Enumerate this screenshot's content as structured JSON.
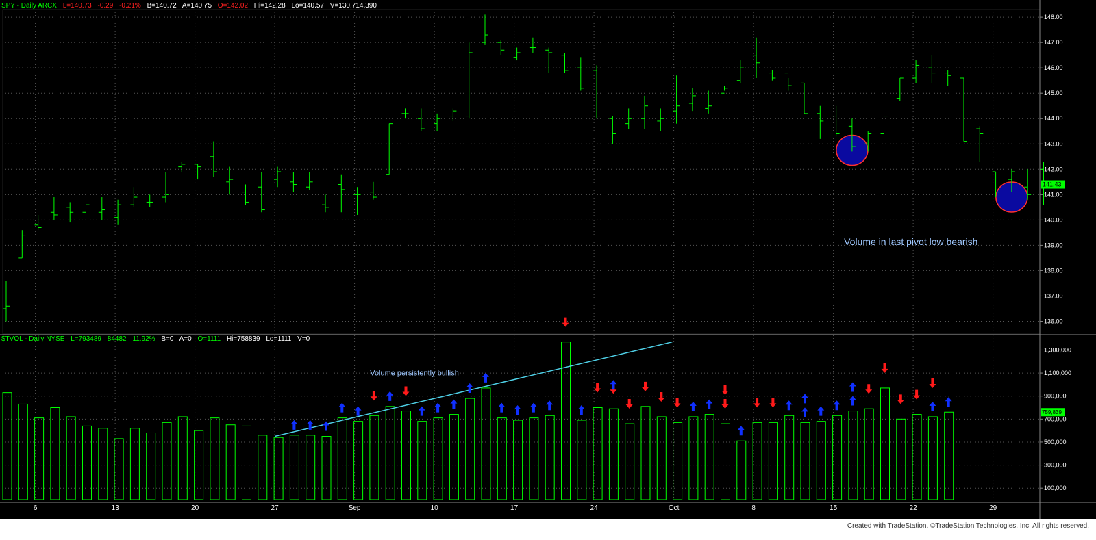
{
  "price_header": {
    "symbol": "SPY - Daily  ARCX",
    "last": "L=140.73",
    "change": "-0.29",
    "pct": "-0.21%",
    "bid": "B=140.72",
    "ask": "A=140.75",
    "open": "O=142.02",
    "high": "Hi=142.28",
    "low": "Lo=140.57",
    "vol": "V=130,714,390"
  },
  "volume_header": {
    "symbol": "$TVOL - Daily  NYSE",
    "last": "L=793489",
    "change": "84482",
    "pct": "11.92%",
    "bid": "B=0",
    "ask": "A=0",
    "open": "O=1111",
    "high": "Hi=758839",
    "low": "Lo=1111",
    "vol": "V=0"
  },
  "footer": "Created with TradeStation. ©TradeStation Technologies, Inc. All rights reserved.",
  "colors": {
    "background": "#000000",
    "bars": "#00ff00",
    "grid": "#555555",
    "trendline": "#4fd1e8",
    "up_arrow": "#1030ff",
    "down_arrow": "#ff1a1a",
    "circle_fill": "#0a0aa0",
    "circle_stroke": "#ff3030",
    "annotation": "#9fc8ff"
  },
  "chart_data": [
    {
      "type": "ohlc",
      "ylim": [
        135.5,
        148.3
      ],
      "yticks": [
        136,
        137,
        138,
        139,
        140,
        141,
        142,
        143,
        144,
        145,
        146,
        147,
        148
      ],
      "ytick_labels": [
        "136.00",
        "137.00",
        "138.00",
        "139.00",
        "140.00",
        "141.00",
        "142.00",
        "143.00",
        "144.00",
        "145.00",
        "146.00",
        "147.00",
        "148.00"
      ],
      "last_price_label": "141.43",
      "xtick_labels": [
        "6",
        "13",
        "20",
        "27",
        "Sep",
        "10",
        "17",
        "24",
        "Oct",
        "8",
        "15",
        "22",
        "29"
      ],
      "xtick_bar_index": [
        2,
        7,
        12,
        17,
        22,
        27,
        32,
        37,
        42,
        47,
        52,
        57,
        62
      ],
      "bars": [
        {
          "o": 136.5,
          "h": 137.6,
          "l": 136.0,
          "c": 136.6
        },
        {
          "o": 138.5,
          "h": 139.6,
          "l": 138.5,
          "c": 139.4
        },
        {
          "o": 139.8,
          "h": 140.2,
          "l": 139.6,
          "c": 139.7
        },
        {
          "o": 140.3,
          "h": 140.9,
          "l": 140.0,
          "c": 140.2
        },
        {
          "o": 140.5,
          "h": 140.7,
          "l": 139.9,
          "c": 140.3
        },
        {
          "o": 140.3,
          "h": 140.8,
          "l": 140.2,
          "c": 140.6
        },
        {
          "o": 140.3,
          "h": 140.9,
          "l": 140.0,
          "c": 140.4
        },
        {
          "o": 140.1,
          "h": 140.8,
          "l": 139.8,
          "c": 140.6
        },
        {
          "o": 140.6,
          "h": 141.3,
          "l": 140.5,
          "c": 140.9
        },
        {
          "o": 140.7,
          "h": 141.0,
          "l": 140.5,
          "c": 140.7
        },
        {
          "o": 140.9,
          "h": 141.9,
          "l": 140.7,
          "c": 141.0
        },
        {
          "o": 142.1,
          "h": 142.3,
          "l": 141.9,
          "c": 142.2
        },
        {
          "o": 142.2,
          "h": 142.2,
          "l": 141.6,
          "c": 142.1
        },
        {
          "o": 142.5,
          "h": 143.1,
          "l": 141.7,
          "c": 141.9
        },
        {
          "o": 141.5,
          "h": 142.1,
          "l": 141.0,
          "c": 141.6
        },
        {
          "o": 141.1,
          "h": 141.4,
          "l": 140.6,
          "c": 140.7
        },
        {
          "o": 141.3,
          "h": 141.9,
          "l": 140.3,
          "c": 140.4
        },
        {
          "o": 141.6,
          "h": 142.1,
          "l": 141.3,
          "c": 141.9
        },
        {
          "o": 141.5,
          "h": 141.9,
          "l": 141.1,
          "c": 141.4
        },
        {
          "o": 141.3,
          "h": 141.9,
          "l": 141.2,
          "c": 141.5
        },
        {
          "o": 140.6,
          "h": 141.0,
          "l": 140.3,
          "c": 140.5
        },
        {
          "o": 141.4,
          "h": 141.8,
          "l": 140.3,
          "c": 141.2
        },
        {
          "o": 141.0,
          "h": 141.3,
          "l": 140.2,
          "c": 141.0
        },
        {
          "o": 141.1,
          "h": 141.5,
          "l": 140.8,
          "c": 140.9
        },
        {
          "o": 141.8,
          "h": 143.8,
          "l": 141.8,
          "c": 143.8
        },
        {
          "o": 144.2,
          "h": 144.4,
          "l": 144.0,
          "c": 144.2
        },
        {
          "o": 144.0,
          "h": 144.4,
          "l": 143.5,
          "c": 143.6
        },
        {
          "o": 143.8,
          "h": 144.2,
          "l": 143.5,
          "c": 144.0
        },
        {
          "o": 144.1,
          "h": 144.4,
          "l": 143.9,
          "c": 144.3
        },
        {
          "o": 144.1,
          "h": 147.0,
          "l": 144.0,
          "c": 146.6
        },
        {
          "o": 147.0,
          "h": 148.1,
          "l": 146.9,
          "c": 147.3
        },
        {
          "o": 147.0,
          "h": 147.1,
          "l": 146.5,
          "c": 146.7
        },
        {
          "o": 146.4,
          "h": 146.8,
          "l": 146.3,
          "c": 146.6
        },
        {
          "o": 146.8,
          "h": 147.2,
          "l": 146.6,
          "c": 146.8
        },
        {
          "o": 146.7,
          "h": 146.8,
          "l": 145.8,
          "c": 146.6
        },
        {
          "o": 146.5,
          "h": 146.6,
          "l": 145.8,
          "c": 145.9
        },
        {
          "o": 146.0,
          "h": 146.4,
          "l": 145.1,
          "c": 145.2
        },
        {
          "o": 145.9,
          "h": 146.1,
          "l": 144.0,
          "c": 144.1
        },
        {
          "o": 144.0,
          "h": 144.1,
          "l": 143.0,
          "c": 143.4
        },
        {
          "o": 143.8,
          "h": 144.4,
          "l": 143.6,
          "c": 144.0
        },
        {
          "o": 144.0,
          "h": 144.9,
          "l": 143.6,
          "c": 144.5
        },
        {
          "o": 143.9,
          "h": 144.4,
          "l": 143.5,
          "c": 144.0
        },
        {
          "o": 144.3,
          "h": 145.7,
          "l": 143.8,
          "c": 144.5
        },
        {
          "o": 144.6,
          "h": 145.2,
          "l": 144.3,
          "c": 144.9
        },
        {
          "o": 144.4,
          "h": 145.1,
          "l": 144.2,
          "c": 144.5
        },
        {
          "o": 145.0,
          "h": 145.3,
          "l": 145.1,
          "c": 145.2
        },
        {
          "o": 145.5,
          "h": 146.3,
          "l": 145.4,
          "c": 146.0
        },
        {
          "o": 146.5,
          "h": 147.2,
          "l": 145.6,
          "c": 146.2
        },
        {
          "o": 145.8,
          "h": 145.9,
          "l": 145.5,
          "c": 145.6
        },
        {
          "o": 145.8,
          "h": 145.6,
          "l": 145.1,
          "c": 145.3
        },
        {
          "o": 145.4,
          "h": 145.4,
          "l": 144.2,
          "c": 144.2
        },
        {
          "o": 144.2,
          "h": 144.5,
          "l": 143.2,
          "c": 143.9
        },
        {
          "o": 144.1,
          "h": 144.5,
          "l": 143.3,
          "c": 143.4
        },
        {
          "o": 143.7,
          "h": 144.0,
          "l": 142.7,
          "c": 142.9
        },
        {
          "o": 143.0,
          "h": 143.5,
          "l": 142.7,
          "c": 143.4
        },
        {
          "o": 143.4,
          "h": 144.2,
          "l": 143.2,
          "c": 144.1
        },
        {
          "o": 144.8,
          "h": 145.6,
          "l": 144.7,
          "c": 145.6
        },
        {
          "o": 145.6,
          "h": 146.3,
          "l": 145.4,
          "c": 146.1
        },
        {
          "o": 146.0,
          "h": 146.5,
          "l": 145.4,
          "c": 145.8
        },
        {
          "o": 145.8,
          "h": 145.9,
          "l": 145.3,
          "c": 145.7
        },
        {
          "o": 145.6,
          "h": 145.6,
          "l": 143.1,
          "c": 143.1
        },
        {
          "o": 143.6,
          "h": 143.7,
          "l": 142.3,
          "c": 143.4
        },
        {
          "o": 141.9,
          "h": 141.9,
          "l": 140.9,
          "c": 141.1
        },
        {
          "o": 141.6,
          "h": 142.0,
          "l": 141.1,
          "c": 141.9
        },
        {
          "o": 141.3,
          "h": 142.0,
          "l": 140.8,
          "c": 141.0
        },
        {
          "o": 142.0,
          "h": 142.3,
          "l": 140.6,
          "c": 141.4
        }
      ],
      "circles": [
        {
          "bar": 53,
          "price": 142.75
        },
        {
          "bar": 63,
          "price": 140.9
        }
      ],
      "annotation": {
        "text": "Volume  in last pivot low bearish",
        "bar": 57,
        "price": 139.15
      }
    },
    {
      "type": "bar",
      "ylim": [
        0,
        1380000
      ],
      "yticks": [
        100000,
        300000,
        500000,
        700000,
        900000,
        1100000,
        1300000
      ],
      "ytick_labels": [
        "100,000",
        "300,000",
        "500,000",
        "700,000",
        "900,000",
        "1,100,000",
        "1,300,000"
      ],
      "last_value_label": "759,839",
      "values": [
        930000,
        830000,
        710000,
        800000,
        720000,
        640000,
        620000,
        530000,
        620000,
        580000,
        670000,
        720000,
        600000,
        710000,
        650000,
        640000,
        560000,
        540000,
        560000,
        560000,
        550000,
        710000,
        680000,
        730000,
        810000,
        770000,
        680000,
        710000,
        740000,
        880000,
        970000,
        710000,
        690000,
        710000,
        730000,
        1370000,
        690000,
        800000,
        790000,
        660000,
        810000,
        720000,
        670000,
        720000,
        740000,
        660000,
        510000,
        670000,
        670000,
        730000,
        670000,
        680000,
        730000,
        770000,
        790000,
        970000,
        700000,
        740000,
        720000,
        760000
      ],
      "bar_offset": 0,
      "arrows": [
        {
          "bar": 18,
          "dir": "up"
        },
        {
          "bar": 19,
          "dir": "up"
        },
        {
          "bar": 20,
          "dir": "up"
        },
        {
          "bar": 21,
          "dir": "up"
        },
        {
          "bar": 22,
          "dir": "up"
        },
        {
          "bar": 23,
          "dir": "down"
        },
        {
          "bar": 24,
          "dir": "up"
        },
        {
          "bar": 25,
          "dir": "down"
        },
        {
          "bar": 26,
          "dir": "up"
        },
        {
          "bar": 27,
          "dir": "up"
        },
        {
          "bar": 28,
          "dir": "up"
        },
        {
          "bar": 29,
          "dir": "up"
        },
        {
          "bar": 30,
          "dir": "up"
        },
        {
          "bar": 31,
          "dir": "up"
        },
        {
          "bar": 32,
          "dir": "up"
        },
        {
          "bar": 33,
          "dir": "up"
        },
        {
          "bar": 34,
          "dir": "up"
        },
        {
          "bar": 35,
          "dir": "down"
        },
        {
          "bar": 36,
          "dir": "up"
        },
        {
          "bar": 37,
          "dir": "down"
        },
        {
          "bar": 38,
          "dir": "down"
        },
        {
          "bar": 38,
          "dir": "up"
        },
        {
          "bar": 39,
          "dir": "down"
        },
        {
          "bar": 40,
          "dir": "down"
        },
        {
          "bar": 41,
          "dir": "down"
        },
        {
          "bar": 42,
          "dir": "down"
        },
        {
          "bar": 43,
          "dir": "up"
        },
        {
          "bar": 44,
          "dir": "up"
        },
        {
          "bar": 45,
          "dir": "down"
        },
        {
          "bar": 45,
          "dir": "down"
        },
        {
          "bar": 46,
          "dir": "up"
        },
        {
          "bar": 47,
          "dir": "down"
        },
        {
          "bar": 48,
          "dir": "down"
        },
        {
          "bar": 49,
          "dir": "up"
        },
        {
          "bar": 50,
          "dir": "up"
        },
        {
          "bar": 50,
          "dir": "up"
        },
        {
          "bar": 51,
          "dir": "up"
        },
        {
          "bar": 52,
          "dir": "up"
        },
        {
          "bar": 53,
          "dir": "up"
        },
        {
          "bar": 53,
          "dir": "up"
        },
        {
          "bar": 54,
          "dir": "down"
        },
        {
          "bar": 55,
          "dir": "down"
        },
        {
          "bar": 56,
          "dir": "down"
        },
        {
          "bar": 57,
          "dir": "down"
        },
        {
          "bar": 58,
          "dir": "up"
        },
        {
          "bar": 59,
          "dir": "up"
        },
        {
          "bar": 58,
          "dir": "down"
        }
      ],
      "trendline": {
        "from": {
          "bar": 17,
          "value": 550000
        },
        "to": {
          "bar": 41,
          "value": 1370000
        }
      },
      "annotation": {
        "text": "Volume persistently bullish",
        "bar": 24,
        "value": 1080000
      }
    }
  ]
}
